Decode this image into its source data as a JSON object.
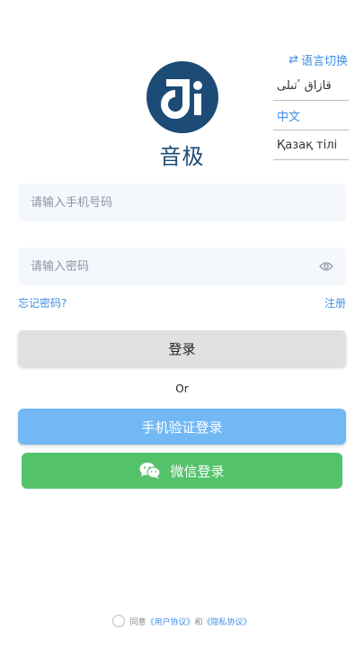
{
  "language": {
    "toggle_label": "语言切换",
    "options": [
      "قازاق ٴتىلى",
      "中文",
      "Қазақ тілі"
    ],
    "selected": "中文"
  },
  "brand": {
    "name": "音极",
    "logo_text": "Ji"
  },
  "form": {
    "phone_placeholder": "请输入手机号码",
    "password_placeholder": "请输入密码",
    "forgot_label": "忘记密码?",
    "register_label": "注册"
  },
  "buttons": {
    "login": "登录",
    "or": "Or",
    "sms_login": "手机验证登录",
    "wechat_login": "微信登录"
  },
  "agreement": {
    "prefix": "同意",
    "user_agreement": "《用户协议》",
    "and": "和",
    "privacy_policy": "《隐私协议》"
  },
  "colors": {
    "brand": "#1c4b76",
    "accent": "#3f8ee6",
    "sms_button": "#72b8f5",
    "wechat_button": "#54c26b"
  }
}
